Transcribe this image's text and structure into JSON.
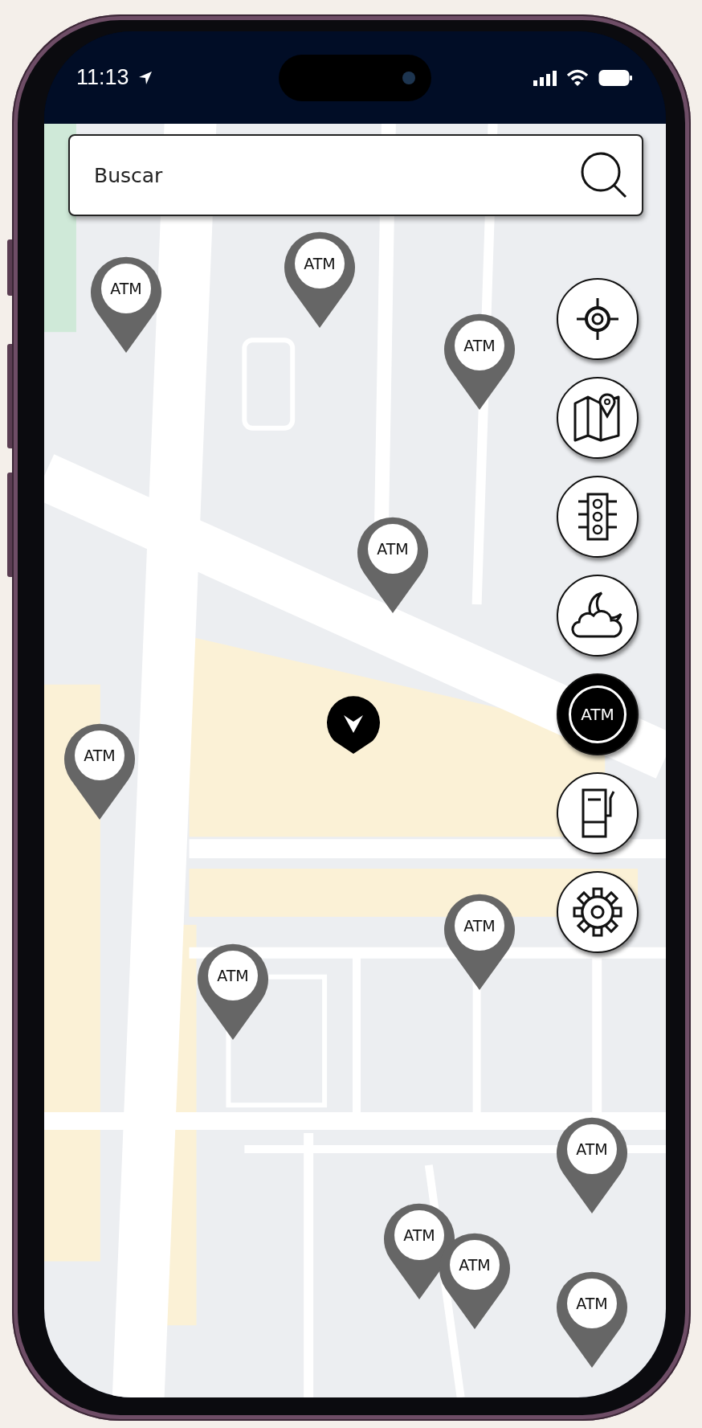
{
  "status_bar": {
    "time": "11:13"
  },
  "search": {
    "placeholder": "Buscar"
  },
  "map_buttons": [
    {
      "kind": "locate",
      "selected": false
    },
    {
      "kind": "map",
      "selected": false
    },
    {
      "kind": "traffic",
      "selected": false
    },
    {
      "kind": "weather",
      "selected": false
    },
    {
      "kind": "atm",
      "label": "ATM",
      "selected": true
    },
    {
      "kind": "fuel",
      "selected": false
    },
    {
      "kind": "settings",
      "selected": false
    }
  ],
  "pins": [
    {
      "label": "ATM"
    },
    {
      "label": "ATM"
    },
    {
      "label": "ATM"
    },
    {
      "label": "ATM"
    },
    {
      "label": "ATM"
    },
    {
      "label": "ATM"
    },
    {
      "label": "ATM"
    },
    {
      "label": "ATM"
    },
    {
      "label": "ATM"
    },
    {
      "label": "ATM"
    },
    {
      "label": "ATM"
    }
  ]
}
